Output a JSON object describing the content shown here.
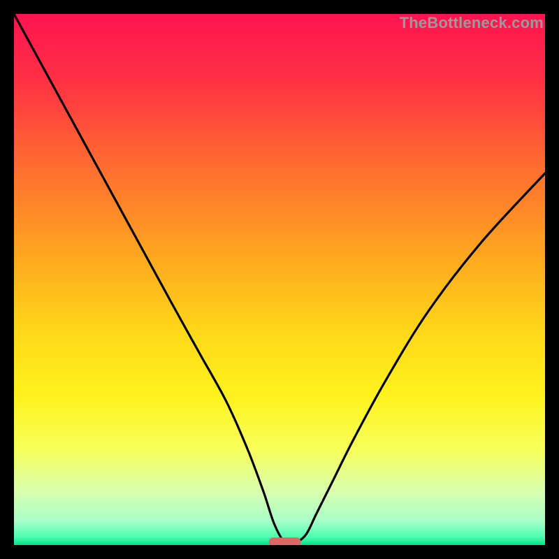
{
  "watermark": "TheBottleneck.com",
  "colors": {
    "frame": "#000000",
    "curve": "#000000",
    "marker_fill": "#e06666",
    "gradient_stops": [
      {
        "offset": 0.0,
        "color": "#ff1450"
      },
      {
        "offset": 0.12,
        "color": "#ff2f45"
      },
      {
        "offset": 0.28,
        "color": "#ff6a30"
      },
      {
        "offset": 0.45,
        "color": "#ffa520"
      },
      {
        "offset": 0.6,
        "color": "#ffd819"
      },
      {
        "offset": 0.72,
        "color": "#fff31e"
      },
      {
        "offset": 0.82,
        "color": "#f7ff5a"
      },
      {
        "offset": 0.9,
        "color": "#d8ffb0"
      },
      {
        "offset": 0.955,
        "color": "#a8ffc8"
      },
      {
        "offset": 0.985,
        "color": "#4cffb0"
      },
      {
        "offset": 1.0,
        "color": "#00e089"
      }
    ]
  },
  "chart_data": {
    "type": "line",
    "title": "",
    "xlabel": "",
    "ylabel": "",
    "xlim": [
      0,
      100
    ],
    "ylim": [
      0,
      100
    ],
    "legend": false,
    "grid": false,
    "series": [
      {
        "name": "bottleneck-curve",
        "x": [
          0,
          6,
          12,
          18,
          24,
          30,
          35,
          40,
          44,
          47,
          49,
          51,
          53,
          55,
          57,
          60,
          64,
          70,
          78,
          88,
          100
        ],
        "values": [
          100,
          89,
          78,
          67,
          56,
          45,
          36,
          27,
          18,
          10,
          4,
          0.5,
          0.5,
          2,
          6,
          12,
          20,
          31,
          44,
          57,
          70
        ]
      }
    ],
    "marker": {
      "x_center": 51,
      "x_half_width": 3,
      "y": 0.5,
      "shape": "rounded-bar"
    },
    "background": "vertical-gradient-heat"
  }
}
